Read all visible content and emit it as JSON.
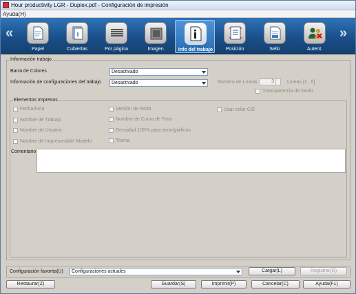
{
  "window": {
    "title": "Hour productivity LGR - Duplex.pdf - Configuración de impresión",
    "menu": [
      "Ayuda(H)"
    ]
  },
  "ribbon": {
    "tabs": [
      {
        "label": "Papel",
        "icon": "paper-icon",
        "active": false
      },
      {
        "label": "Cubiertas",
        "icon": "covers-icon",
        "active": false
      },
      {
        "label": "Por página",
        "icon": "per-page-icon",
        "active": false
      },
      {
        "label": "Imagen",
        "icon": "image-icon",
        "active": false
      },
      {
        "label": "Info del trabajo",
        "icon": "job-info-icon",
        "active": true
      },
      {
        "label": "Posición",
        "icon": "position-icon",
        "active": false
      },
      {
        "label": "Sello",
        "icon": "stamp-icon",
        "active": false
      },
      {
        "label": "Autent.",
        "icon": "authentication-icon",
        "active": false
      }
    ],
    "prev_symbol": "«",
    "next_symbol": "»"
  },
  "job_info": {
    "group_title": "Información trabajo",
    "color_bar_label": "Barra de Colores",
    "color_bar_value": "Desactivado",
    "job_config_label": "Información de configuraciones del trabajo",
    "job_config_value": "Desactivado",
    "lines_label": "Número de Líneas",
    "lines_value": "3",
    "lines_range": "Líneas [1...5]",
    "transparency_label": "Transparencia de fondo"
  },
  "printed_elements": {
    "group_title": "Elementos Impresos",
    "col1": [
      "Fecha/hora",
      "Nombre de Trabajo",
      "Nombre de Usuario",
      "Nombre de Impresora/del Modelo"
    ],
    "col2": [
      "Versión de RGM",
      "Nombre de Curva de Tono",
      "Densidad 100% para texto/gráficos",
      "Trama"
    ],
    "col3": [
      "Usar color CIE"
    ],
    "comment_label": "Comentario"
  },
  "favorites": {
    "label": "Configuración favorita(U)",
    "value": "Configuraciones actuales",
    "load_button": "Cargar(L)",
    "register_button": "Registrar(R)"
  },
  "footer": {
    "restore_button": "Restaurar(Z)",
    "save_button": "Guardar(S)",
    "print_button": "Imprimir(P)",
    "cancel_button": "Cancelar(C)",
    "help_button": "Ayuda(F1)"
  }
}
